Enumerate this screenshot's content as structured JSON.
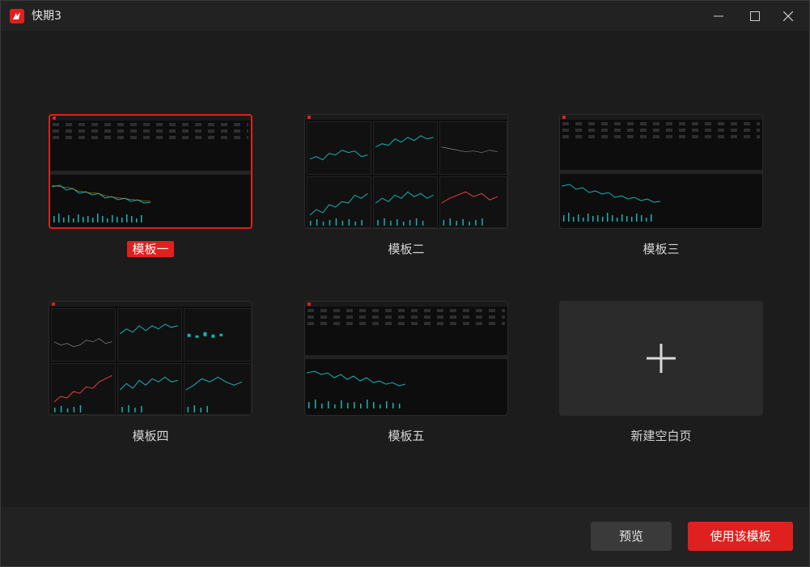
{
  "window": {
    "title": "快期3",
    "logo_icon": "app-logo-icon",
    "controls": [
      "minimize-icon",
      "maximize-icon",
      "close-icon"
    ]
  },
  "templates": [
    {
      "label": "模板一",
      "selected": true
    },
    {
      "label": "模板二",
      "selected": false
    },
    {
      "label": "模板三",
      "selected": false
    },
    {
      "label": "模板四",
      "selected": false
    },
    {
      "label": "模板五",
      "selected": false
    },
    {
      "label": "新建空白页",
      "selected": false,
      "icon": "plus-icon"
    }
  ],
  "footer": {
    "preview_label": "预览",
    "use_label": "使用该模板"
  },
  "colors": {
    "accent": "#e0201e",
    "background": "#1c1c1c",
    "chart_up": "#19b2b2",
    "chart_down": "#e04040"
  }
}
